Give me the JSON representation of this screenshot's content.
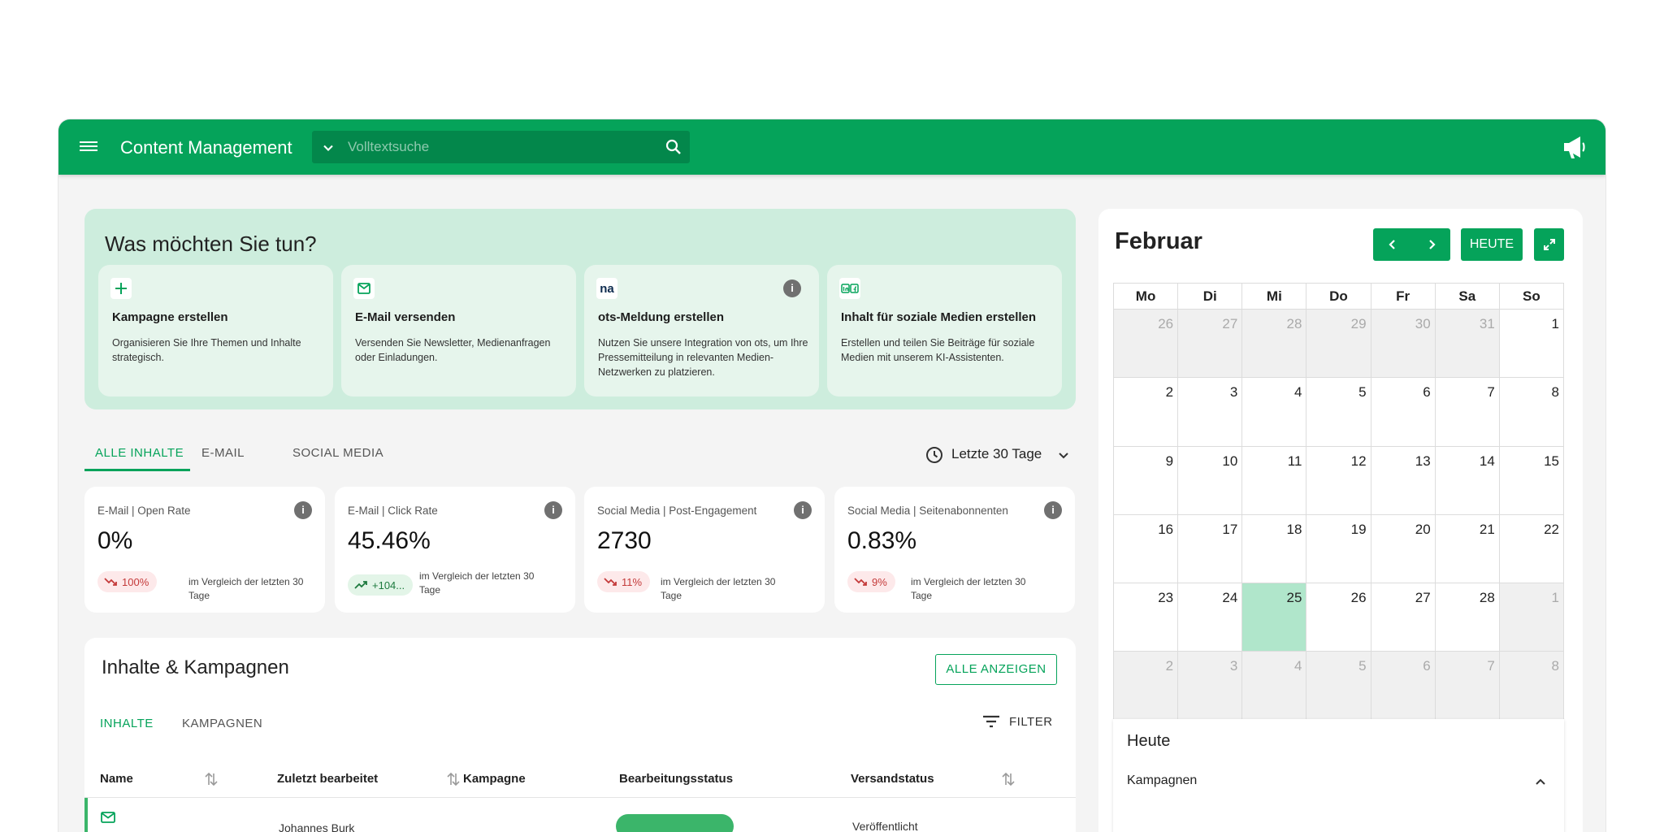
{
  "header": {
    "title": "Content Management",
    "search_placeholder": "Volltextsuche"
  },
  "quick_actions": {
    "title": "Was möchten Sie tun?",
    "cards": [
      {
        "icon": "plus-icon",
        "title": "Kampagne erstellen",
        "desc": "Organisieren Sie Ihre Themen und Inhalte strategisch."
      },
      {
        "icon": "mail-icon",
        "title": "E-Mail versenden",
        "desc": "Versenden Sie Newsletter, Medienanfragen oder Einladungen."
      },
      {
        "icon": "na-logo-icon",
        "logo_text": "na",
        "title": "ots-Meldung erstellen",
        "desc": "Nutzen Sie unsere Integration von ots, um Ihre Pressemitteilung in relevanten Medien-Netzwerken zu platzieren."
      },
      {
        "icon": "social-media-icon",
        "title": "Inhalt für soziale Medien erstellen",
        "desc": "Erstellen und teilen Sie Beiträge für soziale Medien mit unserem KI-Assistenten."
      }
    ]
  },
  "tabs": [
    "ALLE INHALTE",
    "E-MAIL",
    "SOCIAL MEDIA"
  ],
  "period": "Letzte 30 Tage",
  "metrics": [
    {
      "label": "E-Mail | Open Rate",
      "value": "0%",
      "trend": "100%",
      "direction": "down",
      "comparison": "im Vergleich der letzten 30 Tage"
    },
    {
      "label": "E-Mail | Click Rate",
      "value": "45.46%",
      "trend": "+104...",
      "direction": "up",
      "comparison": "im Vergleich der letzten 30 Tage"
    },
    {
      "label": "Social Media | Post-Engagement",
      "value": "2730",
      "trend": "11%",
      "direction": "down",
      "comparison": "im Vergleich der letzten 30 Tage"
    },
    {
      "label": "Social Media | Seitenabonnenten",
      "value": "0.83%",
      "trend": "9%",
      "direction": "down",
      "comparison": "im Vergleich der letzten 30 Tage"
    }
  ],
  "content": {
    "title": "Inhalte & Kampagnen",
    "show_all": "ALLE ANZEIGEN",
    "tabs": [
      "INHALTE",
      "KAMPAGNEN"
    ],
    "filter": "FILTER",
    "columns": [
      "Name",
      "Zuletzt bearbeitet",
      "Kampagne",
      "Bearbeitungsstatus",
      "Versandstatus"
    ],
    "first_row": {
      "edited_by": "Johannes Burk",
      "shipping": "Veröffentlicht"
    }
  },
  "calendar": {
    "month": "Februar",
    "today_label": "HEUTE",
    "weekdays": [
      "Mo",
      "Di",
      "Mi",
      "Do",
      "Fr",
      "Sa",
      "So"
    ],
    "weeks": [
      [
        {
          "d": "26",
          "out": true
        },
        {
          "d": "27",
          "out": true
        },
        {
          "d": "28",
          "out": true
        },
        {
          "d": "29",
          "out": true
        },
        {
          "d": "30",
          "out": true
        },
        {
          "d": "31",
          "out": true
        },
        {
          "d": "1"
        }
      ],
      [
        {
          "d": "2"
        },
        {
          "d": "3"
        },
        {
          "d": "4"
        },
        {
          "d": "5"
        },
        {
          "d": "6"
        },
        {
          "d": "7"
        },
        {
          "d": "8"
        }
      ],
      [
        {
          "d": "9"
        },
        {
          "d": "10"
        },
        {
          "d": "11"
        },
        {
          "d": "12"
        },
        {
          "d": "13"
        },
        {
          "d": "14"
        },
        {
          "d": "15"
        }
      ],
      [
        {
          "d": "16"
        },
        {
          "d": "17"
        },
        {
          "d": "18"
        },
        {
          "d": "19"
        },
        {
          "d": "20"
        },
        {
          "d": "21"
        },
        {
          "d": "22"
        }
      ],
      [
        {
          "d": "23"
        },
        {
          "d": "24"
        },
        {
          "d": "25",
          "today": true
        },
        {
          "d": "26"
        },
        {
          "d": "27"
        },
        {
          "d": "28"
        },
        {
          "d": "1",
          "out": true
        }
      ],
      [
        {
          "d": "2",
          "out": true
        },
        {
          "d": "3",
          "out": true
        },
        {
          "d": "4",
          "out": true
        },
        {
          "d": "5",
          "out": true
        },
        {
          "d": "6",
          "out": true
        },
        {
          "d": "7",
          "out": true
        },
        {
          "d": "8",
          "out": true
        }
      ]
    ],
    "today_panel": {
      "title": "Heute",
      "section": "Kampagnen"
    }
  },
  "colors": {
    "accent": "#05a35a",
    "today": "#b0e6cb",
    "down": "#c43a3a",
    "up": "#1d7a3e"
  }
}
